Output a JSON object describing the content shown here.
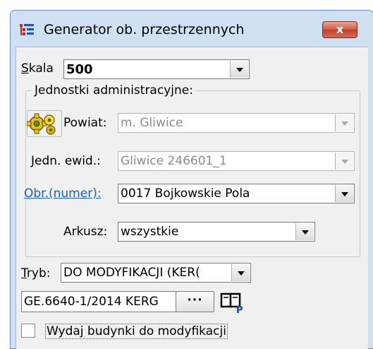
{
  "window": {
    "title": "Generator ob. przestrzennych",
    "close_label": "x"
  },
  "scale": {
    "label": "Skala",
    "value": "500"
  },
  "admin_group": {
    "title": "Jednostki administracyjne:",
    "powiat_label": "Powiat:",
    "powiat_value": "m. Gliwice",
    "jedn_label": "Jedn. ewid.:",
    "jedn_value": "Gliwice 246601_1",
    "obr_label": "Obr.(numer):",
    "obr_value": "0017 Bojkowskie Pola",
    "arkusz_label": "Arkusz:",
    "arkusz_value": "wszystkie"
  },
  "mode": {
    "label": "Tryb:",
    "value": "DO MODYFIKACJI (KER("
  },
  "document": {
    "value": "GE.6640-1/2014 KERG",
    "browse_label": "···"
  },
  "checkbox": {
    "label": "Wydaj budynki do modyfikacji",
    "checked": false
  },
  "colors": {
    "link": "#1a5fb4",
    "close_button": "#c0412a",
    "frame": "#cfe0f2"
  }
}
